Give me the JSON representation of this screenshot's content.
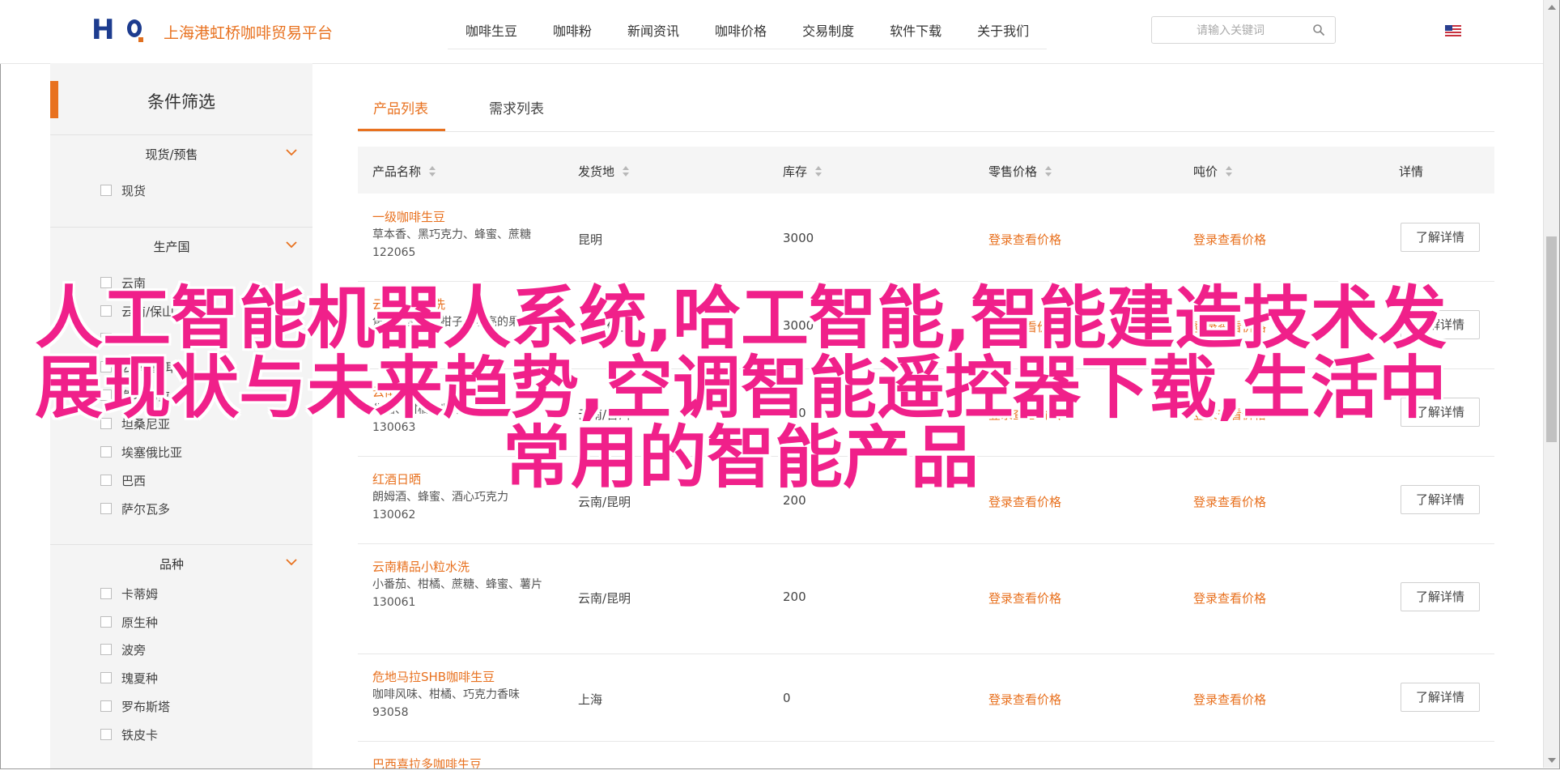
{
  "header": {
    "site_title": "上海港虹桥咖啡贸易平台",
    "nav": [
      "咖啡生豆",
      "咖啡粉",
      "新闻资讯",
      "咖啡价格",
      "交易制度",
      "软件下载",
      "关于我们"
    ],
    "search_placeholder": "请输入关键词"
  },
  "sidebar": {
    "title": "条件筛选",
    "groups": [
      {
        "title": "现货/预售",
        "options": [
          "现货"
        ]
      },
      {
        "title": "生产国",
        "options": [
          "云南",
          "云南/保山",
          "云南保山",
          "云南/普洱",
          "危地马拉",
          "坦桑尼亚",
          "埃塞俄比亚",
          "巴西",
          "萨尔瓦多"
        ]
      },
      {
        "title": "品种",
        "options": [
          "卡蒂姆",
          "原生种",
          "波旁",
          "瑰夏种",
          "罗布斯塔",
          "铁皮卡"
        ]
      }
    ]
  },
  "tabs": [
    "产品列表",
    "需求列表"
  ],
  "table": {
    "headers": [
      "产品名称",
      "发货地",
      "库存",
      "零售价格",
      "吨价",
      "详情"
    ],
    "rows": [
      {
        "name": "一级咖啡生豆",
        "desc": "草本香、黑巧克力、蜂蜜、蔗糖",
        "code": "122065",
        "origin": "昆明",
        "stock": "3000",
        "retail": "登录查看价格",
        "ton": "登录查看价格",
        "detail": "了解详情"
      },
      {
        "name": "云南咖啡水洗",
        "desc": "焦糖、坚果、柑子、明亮的果酸",
        "code": "",
        "origin": "云南/保山",
        "stock": "3000",
        "retail": "登录查看价格",
        "ton": "登录查看价格",
        "detail": "了解详情"
      },
      {
        "name": "云南咖啡",
        "desc": "焦糖、柑橘、坚果",
        "code": "130063",
        "origin": "云南/普洱",
        "stock": "200",
        "retail": "登录查看价格",
        "ton": "登录查看价格",
        "detail": "了解详情"
      },
      {
        "name": "红酒日晒",
        "desc": "朗姆酒、蜂蜜、酒心巧克力",
        "code": "130062",
        "origin": "云南/昆明",
        "stock": "200",
        "retail": "登录查看价格",
        "ton": "登录查看价格",
        "detail": "了解详情"
      },
      {
        "name": "云南精品小粒水洗",
        "desc": "小番茄、柑橘、蔗糖、蜂蜜、薯片",
        "code": "130061",
        "origin": "云南/昆明",
        "stock": "200",
        "retail": "登录查看价格",
        "ton": "登录查看价格",
        "detail": "了解详情"
      },
      {
        "name": "危地马拉SHB咖啡生豆",
        "desc": "咖啡风味、柑橘、巧克力香味",
        "code": "93058",
        "origin": "上海",
        "stock": "0",
        "retail": "登录查看价格",
        "ton": "登录查看价格",
        "detail": "了解详情"
      },
      {
        "name": "巴西喜拉多咖啡生豆",
        "desc": "",
        "code": "",
        "origin": "",
        "stock": "",
        "retail": "",
        "ton": "",
        "detail": ""
      }
    ]
  },
  "overlay_text": "人工智能机器人系统,哈工智能,智能建造技术发展现状与未来趋势,空调智能遥控器下载,生活中常用的智能产品",
  "colors": {
    "accent": "#e8711f",
    "overlay": "#f0208a",
    "logo": "#1d3c8f"
  }
}
